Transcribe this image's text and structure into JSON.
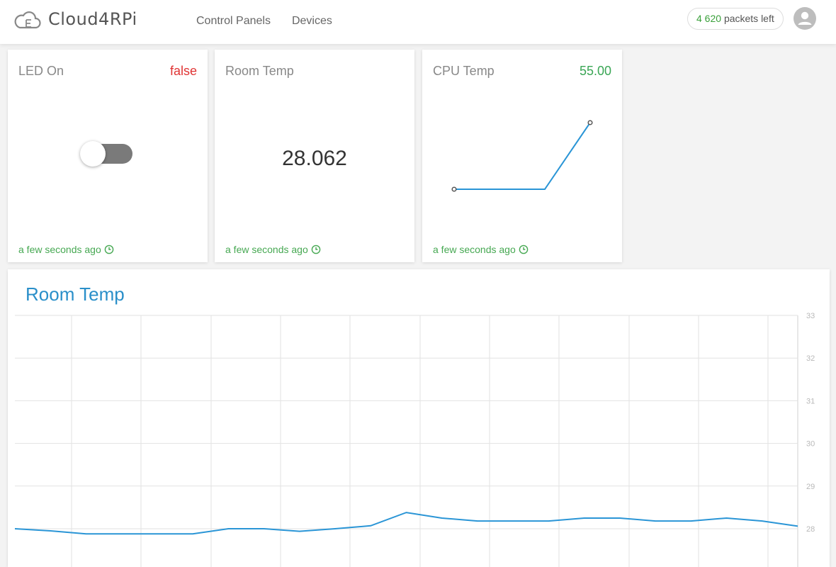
{
  "header": {
    "brand": "Cloud4RPi",
    "nav": [
      "Control Panels",
      "Devices"
    ],
    "packets": {
      "count": "4 620",
      "label": "packets left"
    }
  },
  "widgets": [
    {
      "title": "LED On",
      "value": "false",
      "value_color": "#e03434",
      "footer": "a few seconds ago",
      "type": "switch",
      "state": false
    },
    {
      "title": "Room Temp",
      "value": "",
      "display": "28.062",
      "footer": "a few seconds ago",
      "type": "number"
    },
    {
      "title": "CPU Temp",
      "value": "55.00",
      "value_color": "#3aa655",
      "footer": "a few seconds ago",
      "type": "sparkline",
      "chart_data": {
        "type": "line",
        "values": [
          54,
          54,
          54,
          55
        ]
      }
    }
  ],
  "main_chart": {
    "title": "Room Temp",
    "chart_data": {
      "type": "line",
      "title": "Room Temp",
      "ylim": [
        28,
        33
      ],
      "y_ticks": [
        "28",
        "29",
        "30",
        "31",
        "32",
        "33"
      ],
      "values": [
        28.0,
        27.95,
        27.88,
        27.88,
        27.88,
        27.88,
        28.0,
        28.0,
        27.94,
        28.0,
        28.07,
        28.38,
        28.25,
        28.18,
        28.18,
        28.18,
        28.25,
        28.25,
        28.18,
        28.18,
        28.25,
        28.18,
        28.06
      ],
      "series_color": "#2a95d6",
      "grid": true
    }
  }
}
